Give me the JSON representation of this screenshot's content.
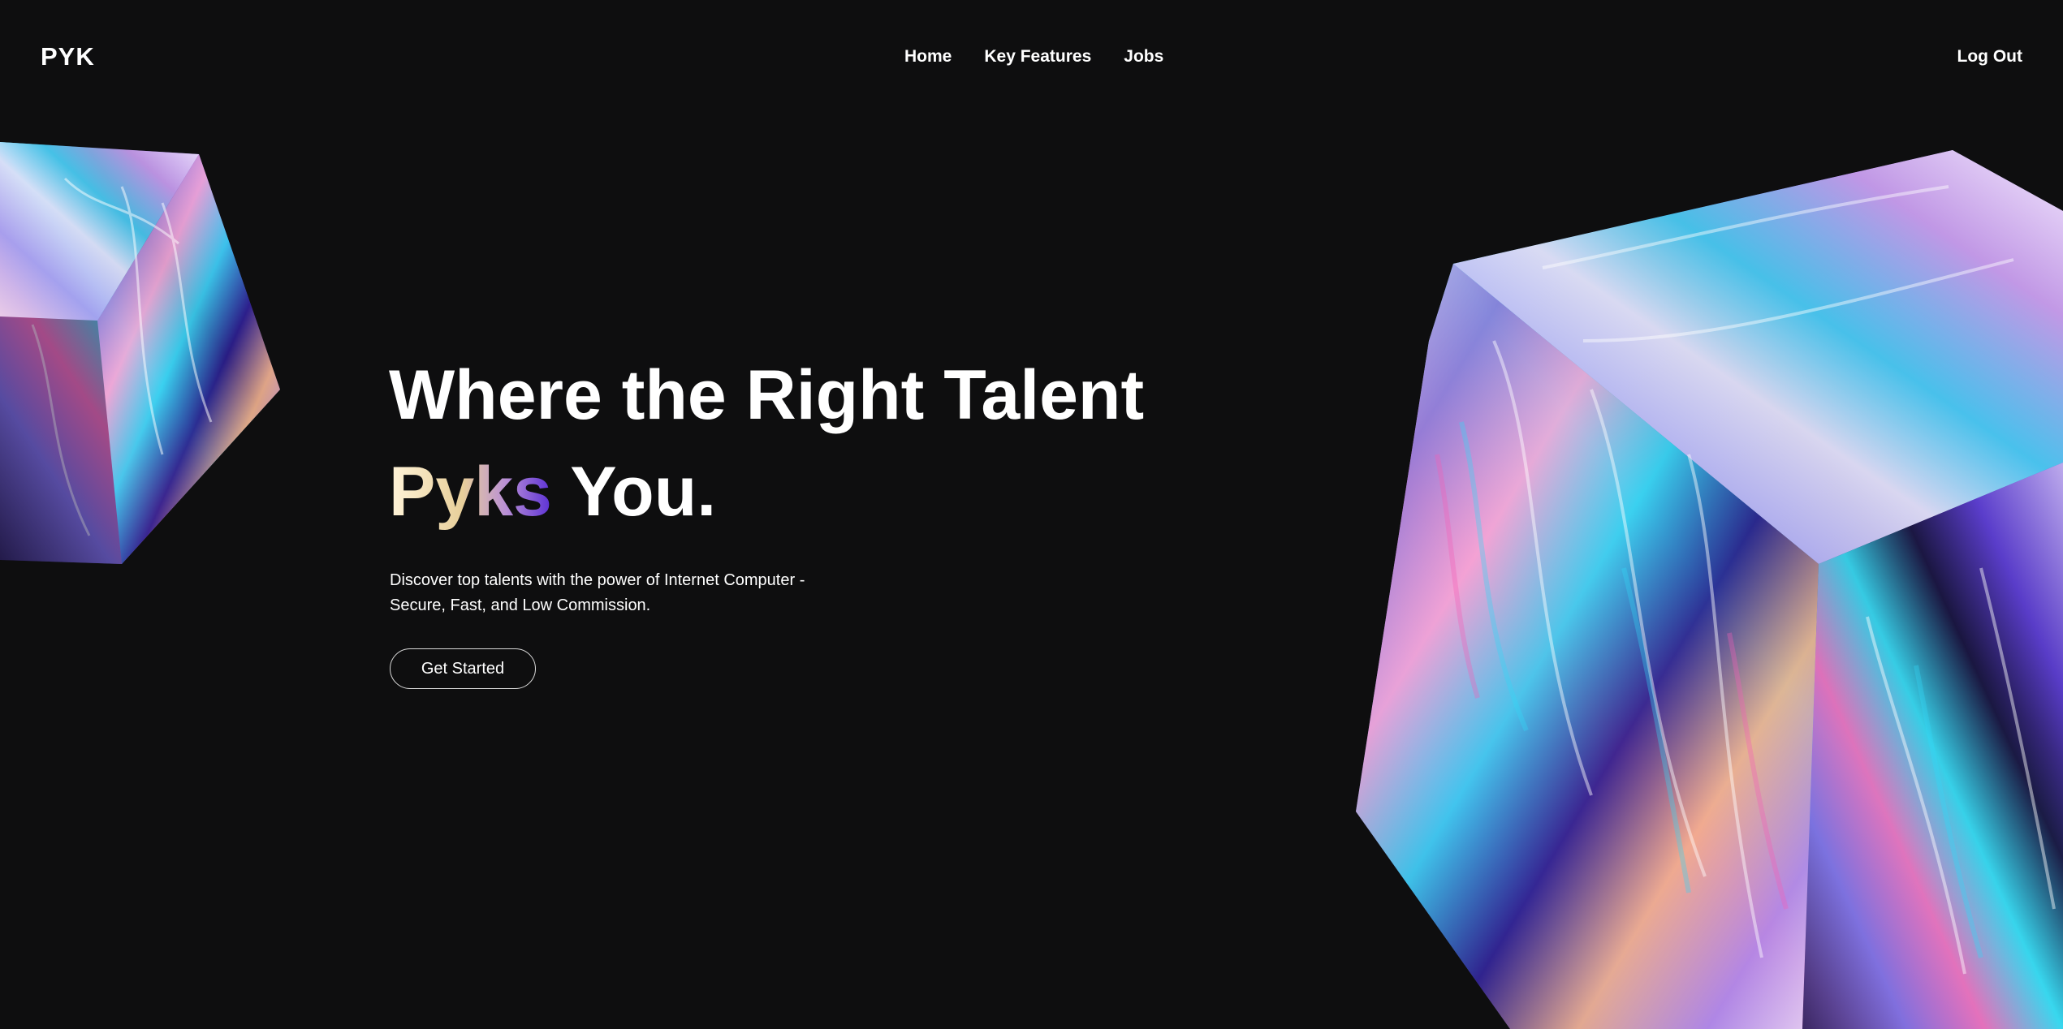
{
  "header": {
    "logo": "PYK",
    "nav": [
      {
        "label": "Home"
      },
      {
        "label": "Key Features"
      },
      {
        "label": "Jobs"
      }
    ],
    "logout_label": "Log Out"
  },
  "hero": {
    "title_line1": "Where the Right Talent",
    "title_accent": "Pyks",
    "title_rest": " You.",
    "description": "Discover top talents with the power of Internet Computer - Secure, Fast, and Low Commission.",
    "cta_label": "Get Started"
  },
  "colors": {
    "background": "#0e0e0f",
    "text": "#ffffff",
    "accent_gradient": [
      "#fff4da",
      "#e8cf9a",
      "#b98fd6",
      "#5a2fd6"
    ]
  },
  "decorations": [
    {
      "name": "crystal-cube-left-icon"
    },
    {
      "name": "crystal-cube-right-icon"
    }
  ]
}
